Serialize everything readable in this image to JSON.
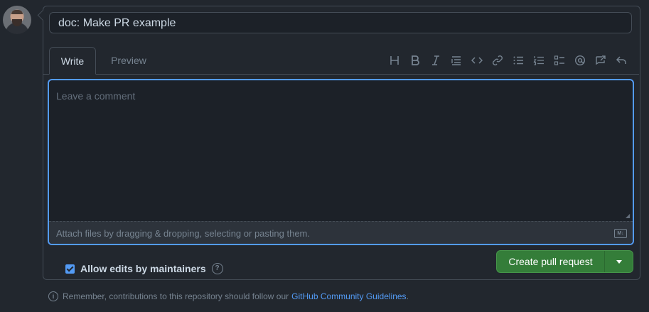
{
  "pr": {
    "title_value": "doc: Make PR example"
  },
  "tabs": {
    "write": "Write",
    "preview": "Preview"
  },
  "toolbar": {
    "icons": [
      "heading-icon",
      "bold-icon",
      "italic-icon",
      "quote-icon",
      "code-icon",
      "link-icon",
      "bulleted-list-icon",
      "numbered-list-icon",
      "task-list-icon",
      "mention-icon",
      "reference-icon",
      "reply-icon"
    ]
  },
  "editor": {
    "placeholder": "Leave a comment",
    "attach_text": "Attach files by dragging & dropping, selecting or pasting them.",
    "markdown_badge": "M↓"
  },
  "options": {
    "allow_edits_label": "Allow edits by maintainers",
    "allow_edits_checked": true,
    "help_glyph": "?"
  },
  "actions": {
    "create_label": "Create pull request"
  },
  "footer": {
    "text": "Remember, contributions to this repository should follow our",
    "link_text": "GitHub Community Guidelines",
    "end": "."
  },
  "colors": {
    "accent": "#539bf5",
    "primary_button": "#347d39",
    "background": "#22272e"
  }
}
